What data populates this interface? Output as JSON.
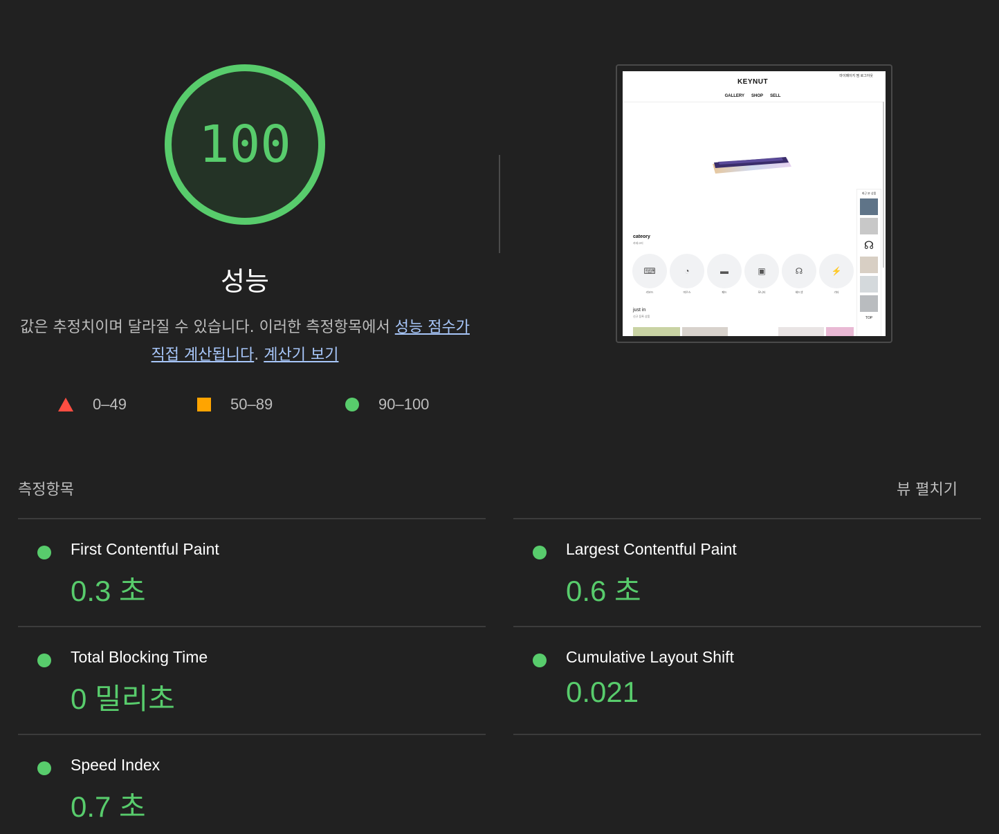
{
  "score": {
    "value": "100",
    "title": "성능",
    "color": "#58cc6c"
  },
  "description": {
    "text": "값은 추정치이며 달라질 수 있습니다. 이러한 측정항목에서 ",
    "link1": "성능 점수가 직접 계산됩니다",
    "sep": ". ",
    "link2": "계산기 보기"
  },
  "legend": [
    {
      "label": "0–49",
      "icon": "red-triangle-icon",
      "color": "#ff4e42"
    },
    {
      "label": "50–89",
      "icon": "orange-square-icon",
      "color": "#ffa400"
    },
    {
      "label": "90–100",
      "icon": "green-circle-icon",
      "color": "#58cc6c"
    }
  ],
  "screenshot": {
    "logo": "KEYNUT",
    "top_links": "마이페이지  찜  로그아웃",
    "nav": [
      "GALLERY",
      "SHOP",
      "SELL"
    ],
    "category_title": "cateory",
    "category_sub": "카테고리",
    "categories": [
      "키보드",
      "마우스",
      "패드",
      "모니터",
      "헤드셋",
      "기타"
    ],
    "just_in": "just in",
    "just_in_sub": "신규 등록 상품",
    "recent_title": "최근 본 상품",
    "top_button": "TOP"
  },
  "metrics_section": {
    "label": "측정항목",
    "toggle": "뷰 펼치기"
  },
  "metrics": [
    {
      "title": "First Contentful Paint",
      "value": "0.3 초"
    },
    {
      "title": "Largest Contentful Paint",
      "value": "0.6 초"
    },
    {
      "title": "Total Blocking Time",
      "value": "0 밀리초"
    },
    {
      "title": "Cumulative Layout Shift",
      "value": "0.021"
    },
    {
      "title": "Speed Index",
      "value": "0.7 초"
    }
  ]
}
